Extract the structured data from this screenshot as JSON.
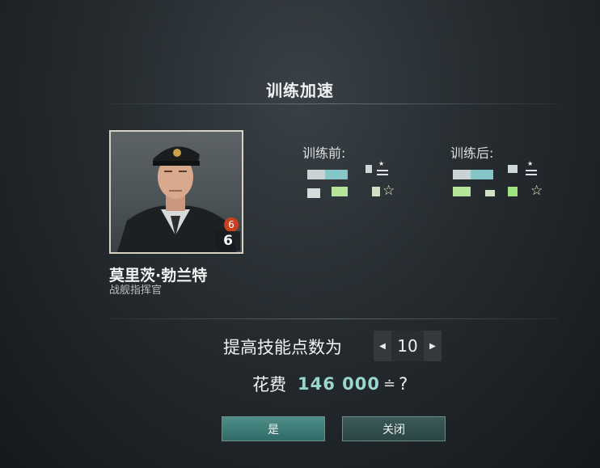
{
  "dialog": {
    "title": "训练加速"
  },
  "commander": {
    "name": "莫里茨·勃兰特",
    "role": "战舰指挥官",
    "level_badge": "6",
    "level": "6",
    "portrait_icon": "commander-portrait"
  },
  "training": {
    "before_label": "训练前:",
    "after_label": "训练后:",
    "star_icon": "star-icon"
  },
  "skill": {
    "prompt": "提高技能点数为",
    "value": "10",
    "decrement_icon": "arrow-left-icon",
    "increment_icon": "arrow-right-icon"
  },
  "cost": {
    "label": "花费",
    "amount": "146 000",
    "currency_glyph": "≐",
    "question": "?"
  },
  "buttons": {
    "confirm": "是",
    "close": "关闭"
  },
  "colors": {
    "accent": "#9ad6d0",
    "confirm_bg": "#2f6a66",
    "badge": "#c8411e"
  }
}
